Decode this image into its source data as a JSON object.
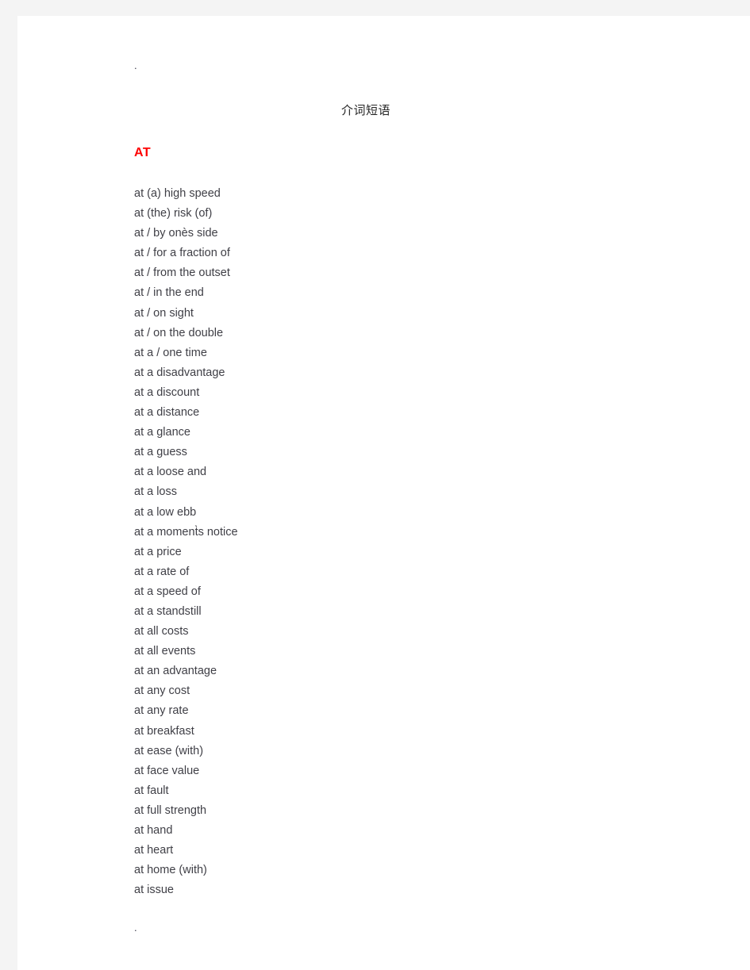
{
  "page": {
    "top_marker": ".",
    "bottom_marker": ".",
    "title": "介词短语"
  },
  "section": {
    "heading": "AT",
    "heading_color": "#fe0000",
    "items": [
      "at (a) high speed",
      "at (the) risk (of)",
      "at / by onès side",
      "at / for a fraction of",
      "at / from the outset",
      "at / in the end",
      "at / on sight",
      "at / on the double",
      "at a / one time",
      "at a disadvantage",
      "at a discount",
      "at a distance",
      "at a glance",
      "at a guess",
      "at a loose and",
      "at a loss",
      "at a low ebb",
      "at a moment̀s notice",
      "at a price",
      "at a rate of",
      "at a speed of",
      "at a standstill",
      "at all costs",
      "at all events",
      "at an advantage",
      "at any cost",
      "at any rate",
      "at breakfast",
      "at ease (with)",
      "at face value",
      "at fault",
      "at full strength",
      "at hand",
      "at heart",
      "at home (with)",
      "at issue"
    ]
  }
}
